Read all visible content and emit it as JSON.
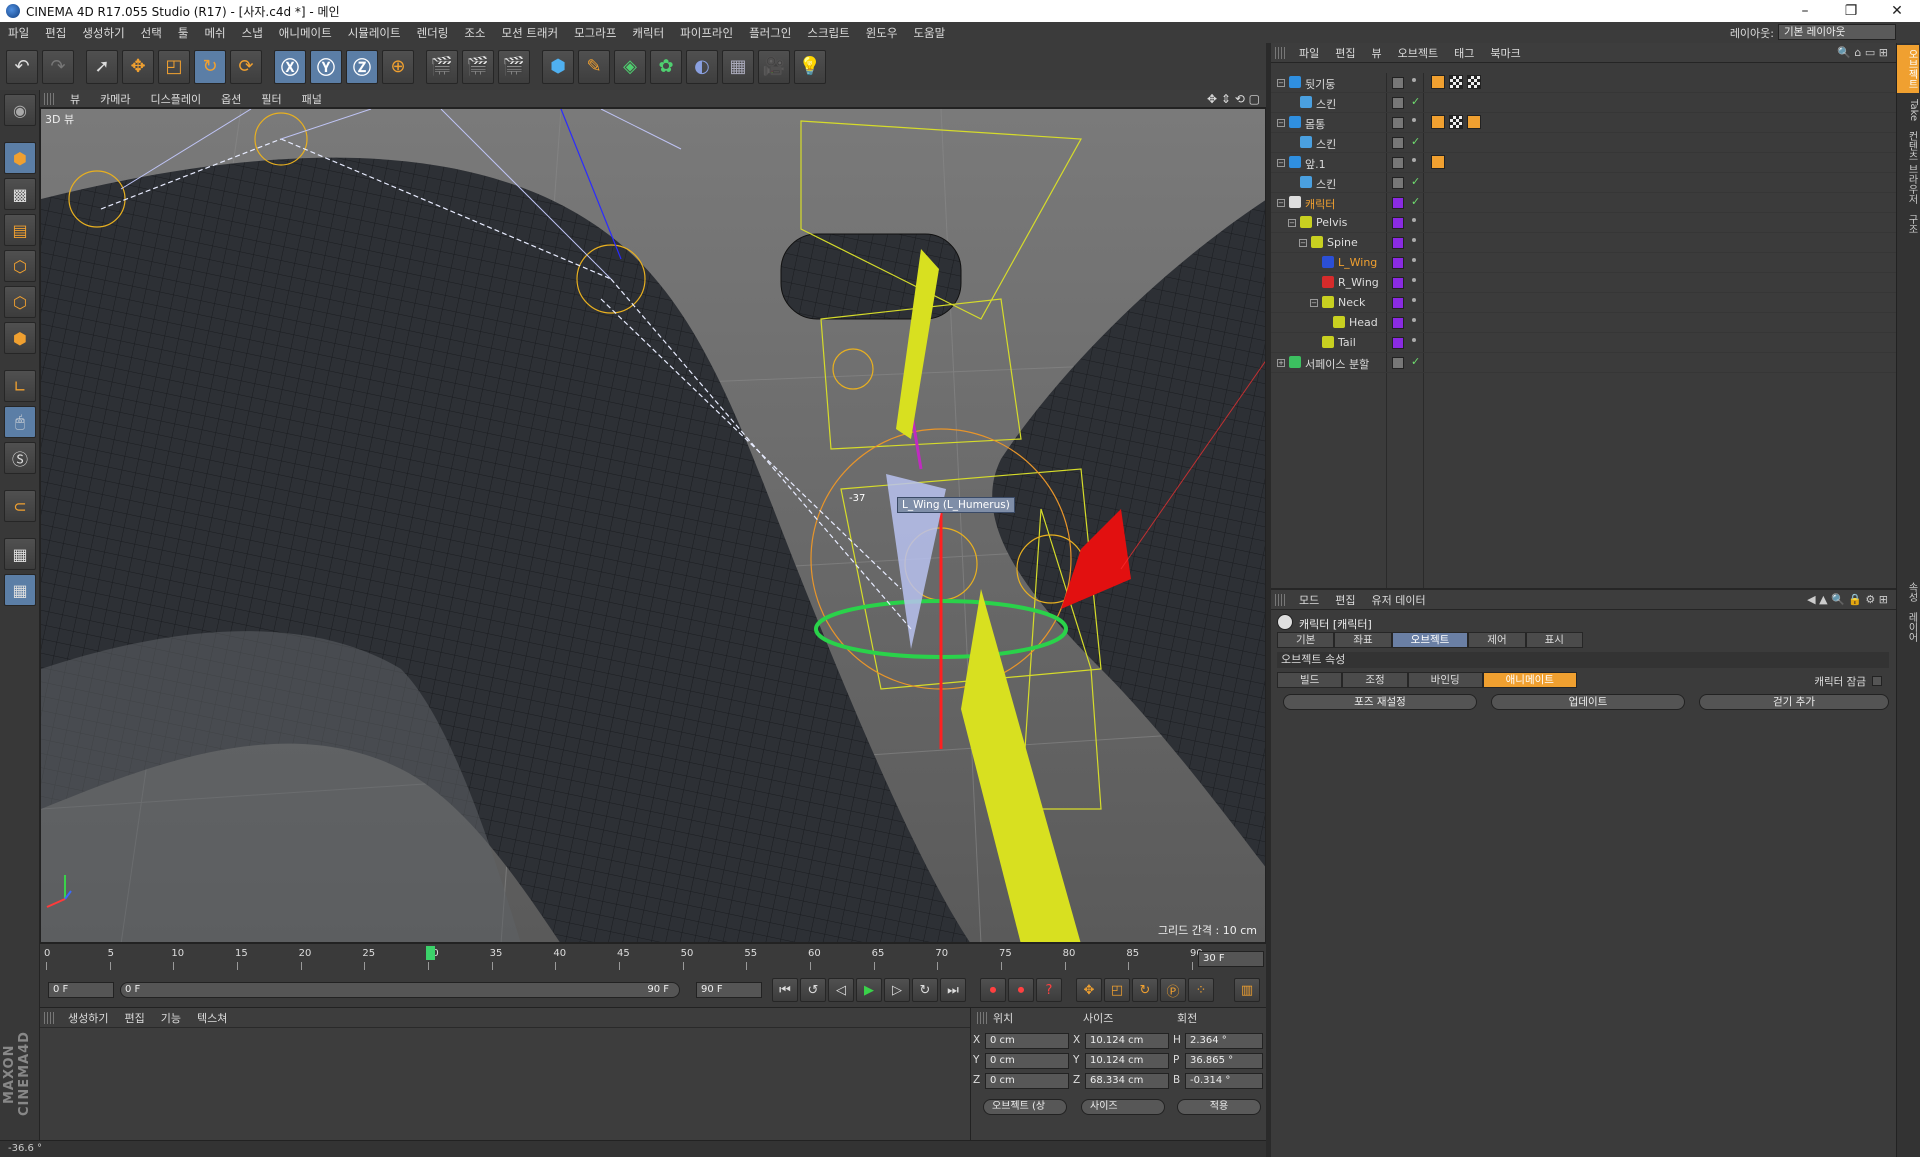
{
  "window": {
    "title": "CINEMA 4D R17.055 Studio (R17) - [사자.c4d *] - 메인"
  },
  "menubar": {
    "items": [
      "파일",
      "편집",
      "생성하기",
      "선택",
      "툴",
      "메쉬",
      "스냅",
      "애니메이트",
      "시뮬레이트",
      "렌더링",
      "조소",
      "모션 트래커",
      "모그라프",
      "캐릭터",
      "파이프라인",
      "플러그인",
      "스크립트",
      "윈도우",
      "도움말"
    ],
    "layout_label": "레이아웃:",
    "layout_value": "기본 레이아웃"
  },
  "viewport": {
    "menu": [
      "뷰",
      "카메라",
      "디스플레이",
      "옵션",
      "필터",
      "패널"
    ],
    "label": "3D 뷰",
    "grid_text": "그리드 간격 : 10 cm",
    "tooltip": "L_Wing (L_Humerus)",
    "coord_hint": "-37"
  },
  "timeline": {
    "ticks": [
      "0",
      "5",
      "10",
      "15",
      "20",
      "25",
      "30",
      "35",
      "40",
      "45",
      "50",
      "55",
      "60",
      "65",
      "70",
      "75",
      "80",
      "85",
      "90"
    ],
    "current_frame": "30",
    "end_frame_field": "30 F"
  },
  "transport": {
    "start_field": "0 F",
    "range_start": "0 F",
    "range_end": "90 F",
    "end_field": "90 F"
  },
  "material_panel": {
    "menu": [
      "생성하기",
      "편집",
      "기능",
      "텍스쳐"
    ]
  },
  "coords": {
    "headers": [
      "위치",
      "사이즈",
      "회전"
    ],
    "rows": [
      {
        "a1": "X",
        "v1": "0 cm",
        "a2": "X",
        "v2": "10.124 cm",
        "a3": "H",
        "v3": "2.364 °"
      },
      {
        "a1": "Y",
        "v1": "0 cm",
        "a2": "Y",
        "v2": "10.124 cm",
        "a3": "P",
        "v3": "36.865 °"
      },
      {
        "a1": "Z",
        "v1": "0 cm",
        "a2": "Z",
        "v2": "68.334 cm",
        "a3": "B",
        "v3": "-0.314 °"
      }
    ],
    "mode_select": "오브젝트 (상",
    "size_select": "사이즈",
    "apply": "적용"
  },
  "status": {
    "text": "-36.6 °"
  },
  "object_manager": {
    "menu": [
      "파일",
      "편집",
      "뷰",
      "오브젝트",
      "태그",
      "북마크"
    ],
    "rows": [
      {
        "name": "뒷기둥",
        "indent": 0,
        "tree": "-",
        "color": "#2f8fe0",
        "tag": "gray",
        "check": false,
        "tags": [
          "orange",
          "checker",
          "checker"
        ]
      },
      {
        "name": "스킨",
        "indent": 1,
        "tree": "",
        "color": "#4aa0e0",
        "tag": "gray",
        "check": true,
        "tags": []
      },
      {
        "name": "몸통",
        "indent": 0,
        "tree": "-",
        "color": "#2f8fe0",
        "tag": "gray",
        "check": false,
        "tags": [
          "orange",
          "checker",
          "orange"
        ]
      },
      {
        "name": "스킨",
        "indent": 1,
        "tree": "",
        "color": "#4aa0e0",
        "tag": "gray",
        "check": true,
        "tags": []
      },
      {
        "name": "앞.1",
        "indent": 0,
        "tree": "-",
        "color": "#2f8fe0",
        "tag": "gray",
        "check": false,
        "tags": [
          "orange"
        ]
      },
      {
        "name": "스킨",
        "indent": 1,
        "tree": "",
        "color": "#4aa0e0",
        "tag": "gray",
        "check": true,
        "tags": []
      },
      {
        "name": "캐릭터",
        "indent": 0,
        "tree": "-",
        "color": "#dddddd",
        "tag": "purple",
        "check": true,
        "tags": [],
        "orange": true
      },
      {
        "name": "Pelvis",
        "indent": 1,
        "tree": "-",
        "color": "#c8d020",
        "tag": "purple",
        "check": false,
        "tags": []
      },
      {
        "name": "Spine",
        "indent": 2,
        "tree": "-",
        "color": "#c8d020",
        "tag": "purple",
        "check": false,
        "tags": []
      },
      {
        "name": "L_Wing",
        "indent": 3,
        "tree": "",
        "color": "#2b4fd6",
        "tag": "purple",
        "check": false,
        "tags": [],
        "orange": true
      },
      {
        "name": "R_Wing",
        "indent": 3,
        "tree": "",
        "color": "#d62b2b",
        "tag": "purple",
        "check": false,
        "tags": []
      },
      {
        "name": "Neck",
        "indent": 3,
        "tree": "-",
        "color": "#c8d020",
        "tag": "purple",
        "check": false,
        "tags": []
      },
      {
        "name": "Head",
        "indent": 4,
        "tree": "",
        "color": "#c8d020",
        "tag": "purple",
        "check": false,
        "tags": []
      },
      {
        "name": "Tail",
        "indent": 3,
        "tree": "",
        "color": "#c8d020",
        "tag": "purple",
        "check": false,
        "tags": []
      },
      {
        "name": "서페이스 분할",
        "indent": 0,
        "tree": "+",
        "color": "#3cc060",
        "tag": "gray",
        "check": true,
        "tags": []
      }
    ]
  },
  "attribute_manager": {
    "menu": [
      "모드",
      "편집",
      "유저 데이터"
    ],
    "title": "캐릭터 [캐릭터]",
    "tabs": [
      "기본",
      "좌표",
      "오브젝트",
      "제어",
      "표시"
    ],
    "active_tab": "오브젝트",
    "section": "오브젝트 속성",
    "subtabs": [
      "빌드",
      "조정",
      "바인딩",
      "애니메이트"
    ],
    "active_subtab": "애니메이트",
    "lock_label": "캐릭터 잠금",
    "buttons": [
      "포즈 재설정",
      "업데이트",
      "걷기 추가"
    ]
  },
  "side_tabs": [
    "오브젝트",
    "Take",
    "컨텐츠 브라우저",
    "구조",
    "속성",
    "레이어"
  ]
}
